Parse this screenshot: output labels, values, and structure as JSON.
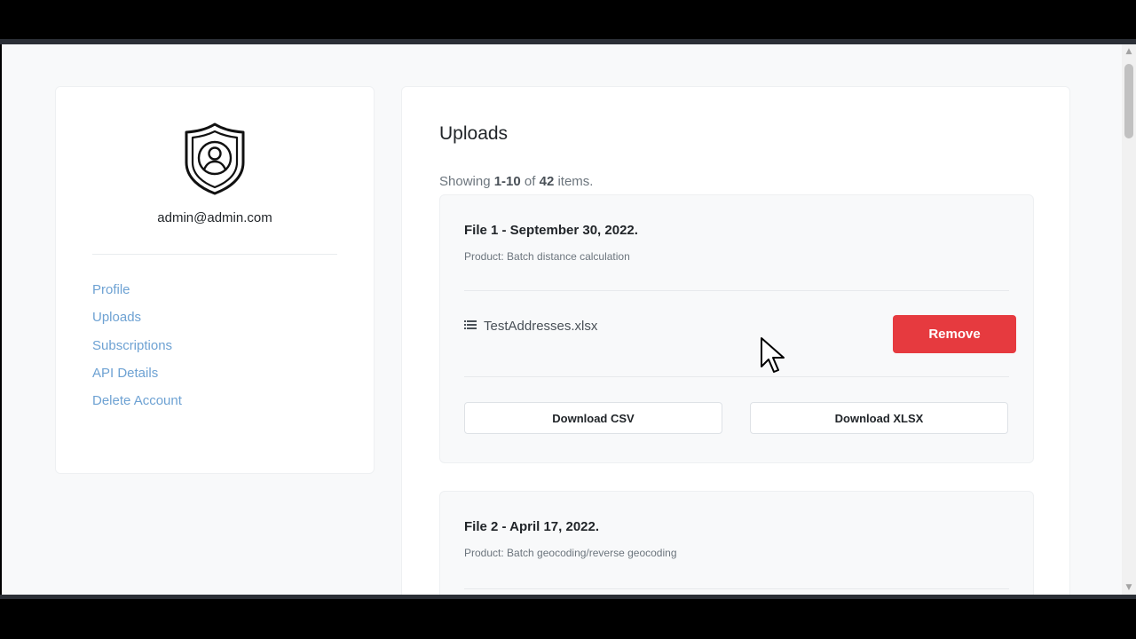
{
  "user": {
    "email": "admin@admin.com"
  },
  "sidebar": {
    "items": [
      {
        "label": "Profile"
      },
      {
        "label": "Uploads"
      },
      {
        "label": "Subscriptions"
      },
      {
        "label": "API Details"
      },
      {
        "label": "Delete Account"
      }
    ]
  },
  "uploads": {
    "title": "Uploads",
    "summary": {
      "prefix": "Showing ",
      "range": "1-10",
      "of": " of ",
      "total": "42",
      "suffix": " items."
    },
    "files": [
      {
        "title": "File 1 - September 30, 2022.",
        "product": "Product: Batch distance calculation",
        "filename": "TestAddresses.xlsx",
        "remove_label": "Remove",
        "download_csv_label": "Download CSV",
        "download_xlsx_label": "Download XLSX"
      },
      {
        "title": "File 2 - April 17, 2022.",
        "product": "Product: Batch geocoding/reverse geocoding"
      }
    ]
  },
  "icons": {
    "avatar": "shield-user-icon",
    "file": "list-icon",
    "cursor": "mouse-pointer-icon",
    "scroll_up": "chevron-up-icon",
    "scroll_down": "chevron-down-icon"
  },
  "colors": {
    "link": "#6ea2d3",
    "danger": "#e63a3f",
    "background": "#f8f9fa"
  }
}
